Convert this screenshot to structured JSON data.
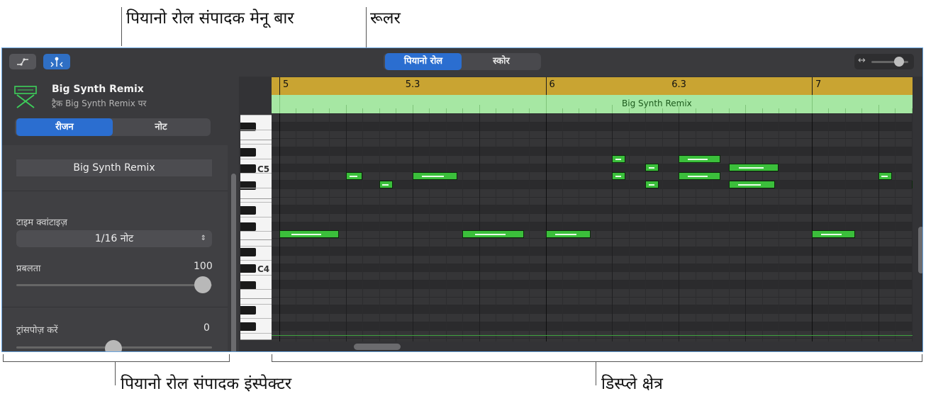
{
  "callouts": {
    "menu_bar": "पियानो रोल संपादक मेनू बार",
    "ruler": "रूलर",
    "inspector": "पियानो रोल संपादक इंस्पेक्टर",
    "display": "डिस्प्ले क्षेत्र"
  },
  "view_switch": {
    "piano_roll": "पियानो रोल",
    "score": "स्कोर"
  },
  "zoom": {
    "icon": "↔",
    "level": 0.7
  },
  "track": {
    "name": "Big Synth Remix",
    "description": "ट्रैक Big Synth Remix पर"
  },
  "inspector_tabs": {
    "region": "रीजन",
    "note": "नोट"
  },
  "inspector": {
    "region_name": "Big Synth Remix",
    "time_quantize_label": "टाइम क्वांटाइज़",
    "time_quantize_value": "1/16 नोट",
    "velocity_label": "प्रबलता",
    "velocity_value": "100",
    "transpose_label": "ट्रांसपोज़ करें",
    "transpose_value": "0"
  },
  "ruler": {
    "labels": [
      "5",
      "5.3",
      "6",
      "6.3",
      "7"
    ]
  },
  "region_label": "Big Synth Remix",
  "keys": {
    "c5": "C5",
    "c4": "C4"
  },
  "colors": {
    "accent": "#2b6ed0",
    "ruler": "#c9a432",
    "region": "#a6e7a3",
    "note": "#3bbf3b"
  }
}
